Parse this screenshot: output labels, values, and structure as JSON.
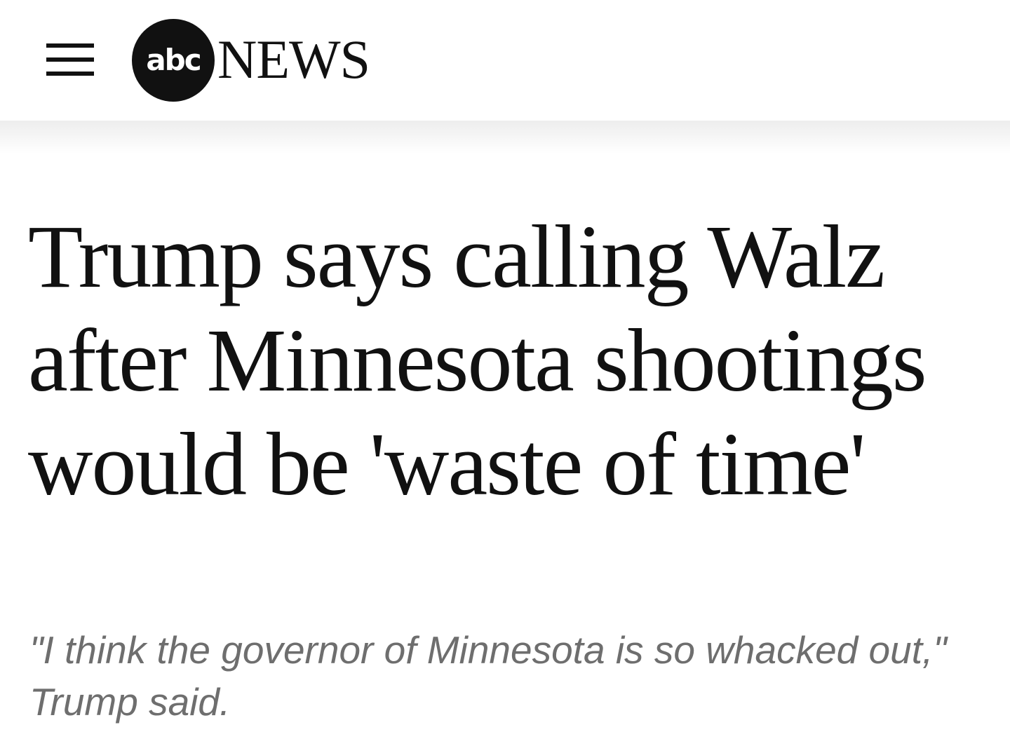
{
  "header": {
    "menu_icon": "hamburger-menu-icon",
    "logo": {
      "mark_text": "abc",
      "wordmark": "NEWS"
    }
  },
  "article": {
    "headline": "Trump says calling Walz after Minnesota shootings would be 'waste of time'",
    "subheadline": "\"I think the governor of Minnesota is so whacked out,\" Trump said."
  },
  "colors": {
    "text": "#111111",
    "subhead": "#6e6e6e",
    "background": "#ffffff"
  }
}
